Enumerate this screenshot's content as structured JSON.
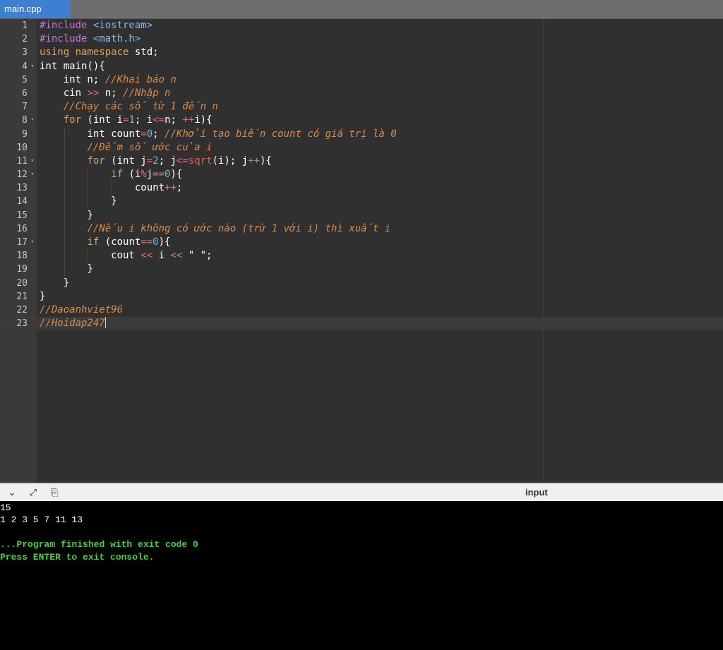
{
  "tab": {
    "label": "main.cpp"
  },
  "editor": {
    "lines": [
      {
        "num": "1",
        "indent": 0,
        "fold": false,
        "tokens": [
          {
            "t": "pp",
            "v": "#include "
          },
          {
            "t": "str",
            "v": "<iostream>"
          }
        ]
      },
      {
        "num": "2",
        "indent": 0,
        "fold": false,
        "tokens": [
          {
            "t": "pp",
            "v": "#include "
          },
          {
            "t": "str",
            "v": "<math.h>"
          }
        ]
      },
      {
        "num": "3",
        "indent": 0,
        "fold": false,
        "tokens": [
          {
            "t": "kw",
            "v": "using namespace"
          },
          {
            "t": "",
            "v": " std;"
          }
        ]
      },
      {
        "num": "4",
        "indent": 0,
        "fold": true,
        "tokens": [
          {
            "t": "",
            "v": "int main(){"
          }
        ]
      },
      {
        "num": "5",
        "indent": 1,
        "fold": false,
        "tokens": [
          {
            "t": "",
            "v": "    int n; "
          },
          {
            "t": "cm",
            "v": "//Khai báo n"
          }
        ]
      },
      {
        "num": "6",
        "indent": 1,
        "fold": false,
        "tokens": [
          {
            "t": "",
            "v": "    cin "
          },
          {
            "t": "op",
            "v": ">>"
          },
          {
            "t": "",
            "v": " n; "
          },
          {
            "t": "cm",
            "v": "//Nhập n"
          }
        ]
      },
      {
        "num": "7",
        "indent": 1,
        "fold": false,
        "tokens": [
          {
            "t": "",
            "v": "    "
          },
          {
            "t": "cm",
            "v": "//Chạy các số từ 1 đến n"
          }
        ]
      },
      {
        "num": "8",
        "indent": 1,
        "fold": true,
        "tokens": [
          {
            "t": "",
            "v": "    "
          },
          {
            "t": "kw",
            "v": "for"
          },
          {
            "t": "",
            "v": " (int i"
          },
          {
            "t": "op",
            "v": "="
          },
          {
            "t": "num",
            "v": "1"
          },
          {
            "t": "",
            "v": "; i"
          },
          {
            "t": "op",
            "v": "<="
          },
          {
            "t": "",
            "v": "n; "
          },
          {
            "t": "op",
            "v": "++"
          },
          {
            "t": "",
            "v": "i){"
          }
        ]
      },
      {
        "num": "9",
        "indent": 2,
        "fold": false,
        "tokens": [
          {
            "t": "",
            "v": "        int count"
          },
          {
            "t": "op",
            "v": "="
          },
          {
            "t": "num",
            "v": "0"
          },
          {
            "t": "",
            "v": "; "
          },
          {
            "t": "cm",
            "v": "//Khởi tạo biến count có giá trị là 0"
          }
        ]
      },
      {
        "num": "10",
        "indent": 2,
        "fold": false,
        "tokens": [
          {
            "t": "",
            "v": "        "
          },
          {
            "t": "cm",
            "v": "//Đếm số ước của i"
          }
        ]
      },
      {
        "num": "11",
        "indent": 2,
        "fold": true,
        "tokens": [
          {
            "t": "",
            "v": "        "
          },
          {
            "t": "kw",
            "v": "for"
          },
          {
            "t": "",
            "v": " (int j"
          },
          {
            "t": "op",
            "v": "="
          },
          {
            "t": "num",
            "v": "2"
          },
          {
            "t": "",
            "v": "; j"
          },
          {
            "t": "op",
            "v": "<="
          },
          {
            "t": "fn",
            "v": "sqrt"
          },
          {
            "t": "",
            "v": "(i); j"
          },
          {
            "t": "op",
            "v": "++"
          },
          {
            "t": "",
            "v": "){"
          }
        ]
      },
      {
        "num": "12",
        "indent": 3,
        "fold": true,
        "tokens": [
          {
            "t": "",
            "v": "            "
          },
          {
            "t": "kw",
            "v": "if"
          },
          {
            "t": "",
            "v": " (i"
          },
          {
            "t": "op",
            "v": "%"
          },
          {
            "t": "",
            "v": "j"
          },
          {
            "t": "op",
            "v": "=="
          },
          {
            "t": "num",
            "v": "0"
          },
          {
            "t": "",
            "v": "){"
          }
        ]
      },
      {
        "num": "13",
        "indent": 4,
        "fold": false,
        "tokens": [
          {
            "t": "",
            "v": "                count"
          },
          {
            "t": "op",
            "v": "++"
          },
          {
            "t": "",
            "v": ";"
          }
        ]
      },
      {
        "num": "14",
        "indent": 3,
        "fold": false,
        "tokens": [
          {
            "t": "",
            "v": "            }"
          }
        ]
      },
      {
        "num": "15",
        "indent": 2,
        "fold": false,
        "tokens": [
          {
            "t": "",
            "v": "        }"
          }
        ]
      },
      {
        "num": "16",
        "indent": 2,
        "fold": false,
        "tokens": [
          {
            "t": "",
            "v": "        "
          },
          {
            "t": "cm",
            "v": "//Nếu i không có ước nào (trừ 1 với i) thì xuất i"
          }
        ]
      },
      {
        "num": "17",
        "indent": 2,
        "fold": true,
        "tokens": [
          {
            "t": "",
            "v": "        "
          },
          {
            "t": "kw",
            "v": "if"
          },
          {
            "t": "",
            "v": " (count"
          },
          {
            "t": "op",
            "v": "=="
          },
          {
            "t": "num",
            "v": "0"
          },
          {
            "t": "",
            "v": "){"
          }
        ]
      },
      {
        "num": "18",
        "indent": 3,
        "fold": false,
        "tokens": [
          {
            "t": "",
            "v": "            cout "
          },
          {
            "t": "op",
            "v": "<<"
          },
          {
            "t": "",
            "v": " i "
          },
          {
            "t": "op",
            "v": "<<"
          },
          {
            "t": "",
            "v": " \" \";"
          }
        ]
      },
      {
        "num": "19",
        "indent": 2,
        "fold": false,
        "tokens": [
          {
            "t": "",
            "v": "        }"
          }
        ]
      },
      {
        "num": "20",
        "indent": 1,
        "fold": false,
        "tokens": [
          {
            "t": "",
            "v": "    }"
          }
        ]
      },
      {
        "num": "21",
        "indent": 0,
        "fold": false,
        "tokens": [
          {
            "t": "",
            "v": "}"
          }
        ]
      },
      {
        "num": "22",
        "indent": 0,
        "fold": false,
        "tokens": [
          {
            "t": "cm",
            "v": "//Daoanhviet96"
          }
        ]
      },
      {
        "num": "23",
        "indent": 0,
        "fold": false,
        "active": true,
        "tokens": [
          {
            "t": "cm",
            "v": "//Hoidap247"
          }
        ]
      }
    ]
  },
  "panel": {
    "label": "input",
    "buttons": [
      {
        "name": "collapse-icon",
        "glyph": "⌄"
      },
      {
        "name": "expand-icon",
        "glyph": "⤢"
      },
      {
        "name": "copy-icon",
        "glyph": "⎘"
      }
    ]
  },
  "console": {
    "lines": [
      {
        "text": "15",
        "style": "normal"
      },
      {
        "text": "1 2 3 5 7 11 13",
        "style": "normal"
      },
      {
        "text": "",
        "style": "normal"
      },
      {
        "text": "...Program finished with exit code 0",
        "style": "green"
      },
      {
        "text": "Press ENTER to exit console.",
        "style": "green"
      }
    ]
  }
}
